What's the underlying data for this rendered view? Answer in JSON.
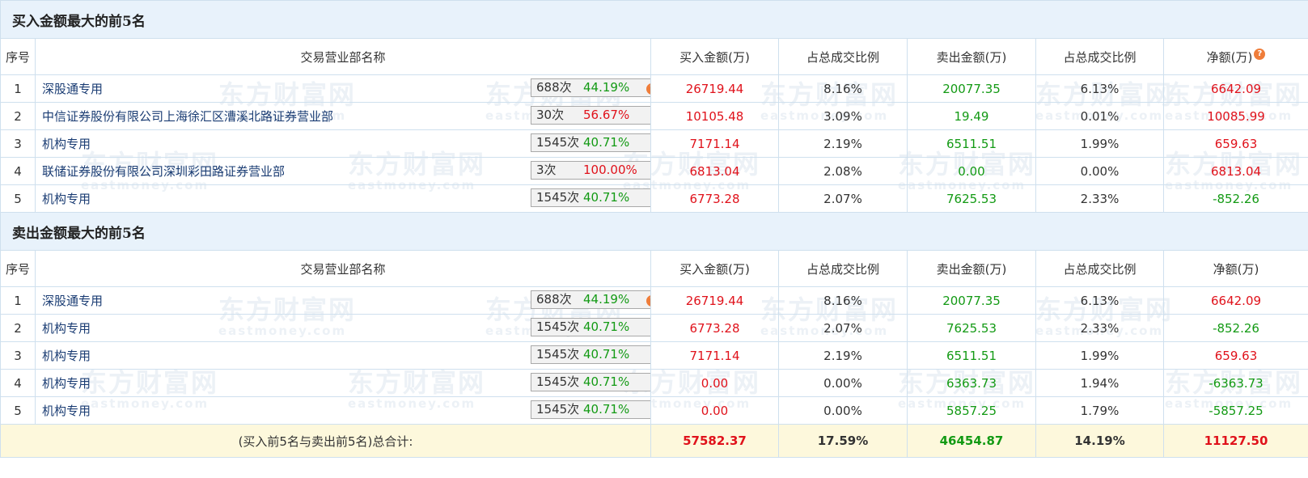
{
  "watermark": {
    "cn": "东方财富网",
    "en": "eastmoney.com"
  },
  "buy_section": {
    "title": "买入金额最大的前5名",
    "headers": [
      "序号",
      "交易营业部名称",
      "买入金额(万)",
      "占总成交比例",
      "卖出金额(万)",
      "占总成交比例",
      "净额(万)"
    ],
    "header_help_icon": "?",
    "rows": [
      {
        "idx": "1",
        "name": "深股通专用",
        "count": "688次",
        "pct": "44.19%",
        "pct_color": "green",
        "icon": "help",
        "buy": "26719.44",
        "buy_ratio": "8.16%",
        "sell": "20077.35",
        "sell_ratio": "6.13%",
        "net": "6642.09",
        "net_color": "red"
      },
      {
        "idx": "2",
        "name": "中信证券股份有限公司上海徐汇区漕溪北路证券营业部",
        "count": "30次",
        "pct": "56.67%",
        "pct_color": "red",
        "icon": "arrow",
        "buy": "10105.48",
        "buy_ratio": "3.09%",
        "sell": "19.49",
        "sell_ratio": "0.01%",
        "net": "10085.99",
        "net_color": "red"
      },
      {
        "idx": "3",
        "name": "机构专用",
        "count": "1545次",
        "pct": "40.71%",
        "pct_color": "green",
        "icon": "arrow",
        "buy": "7171.14",
        "buy_ratio": "2.19%",
        "sell": "6511.51",
        "sell_ratio": "1.99%",
        "net": "659.63",
        "net_color": "red"
      },
      {
        "idx": "4",
        "name": "联储证券股份有限公司深圳彩田路证券营业部",
        "count": "3次",
        "pct": "100.00%",
        "pct_color": "red",
        "icon": "arrow",
        "buy": "6813.04",
        "buy_ratio": "2.08%",
        "sell": "0.00",
        "sell_ratio": "0.00%",
        "net": "6813.04",
        "net_color": "red"
      },
      {
        "idx": "5",
        "name": "机构专用",
        "count": "1545次",
        "pct": "40.71%",
        "pct_color": "green",
        "icon": "arrow",
        "buy": "6773.28",
        "buy_ratio": "2.07%",
        "sell": "7625.53",
        "sell_ratio": "2.33%",
        "net": "-852.26",
        "net_color": "green"
      }
    ]
  },
  "sell_section": {
    "title": "卖出金额最大的前5名",
    "headers": [
      "序号",
      "交易营业部名称",
      "买入金额(万)",
      "占总成交比例",
      "卖出金额(万)",
      "占总成交比例",
      "净额(万)"
    ],
    "rows": [
      {
        "idx": "1",
        "name": "深股通专用",
        "count": "688次",
        "pct": "44.19%",
        "pct_color": "green",
        "icon": "help",
        "buy": "26719.44",
        "buy_ratio": "8.16%",
        "sell": "20077.35",
        "sell_ratio": "6.13%",
        "net": "6642.09",
        "net_color": "red"
      },
      {
        "idx": "2",
        "name": "机构专用",
        "count": "1545次",
        "pct": "40.71%",
        "pct_color": "green",
        "icon": "arrow",
        "buy": "6773.28",
        "buy_ratio": "2.07%",
        "sell": "7625.53",
        "sell_ratio": "2.33%",
        "net": "-852.26",
        "net_color": "green"
      },
      {
        "idx": "3",
        "name": "机构专用",
        "count": "1545次",
        "pct": "40.71%",
        "pct_color": "green",
        "icon": "arrow",
        "buy": "7171.14",
        "buy_ratio": "2.19%",
        "sell": "6511.51",
        "sell_ratio": "1.99%",
        "net": "659.63",
        "net_color": "red"
      },
      {
        "idx": "4",
        "name": "机构专用",
        "count": "1545次",
        "pct": "40.71%",
        "pct_color": "green",
        "icon": "arrow",
        "buy": "0.00",
        "buy_ratio": "0.00%",
        "sell": "6363.73",
        "sell_ratio": "1.94%",
        "net": "-6363.73",
        "net_color": "green"
      },
      {
        "idx": "5",
        "name": "机构专用",
        "count": "1545次",
        "pct": "40.71%",
        "pct_color": "green",
        "icon": "arrow",
        "buy": "0.00",
        "buy_ratio": "0.00%",
        "sell": "5857.25",
        "sell_ratio": "1.79%",
        "net": "-5857.25",
        "net_color": "green"
      }
    ]
  },
  "total": {
    "label": "(买入前5名与卖出前5名)总合计:",
    "buy": "57582.37",
    "buy_ratio": "17.59%",
    "sell": "46454.87",
    "sell_ratio": "14.19%",
    "net": "11127.50"
  },
  "colors": {
    "up": "#e0121b",
    "down": "#139a14",
    "header_bg": "#e8f2fb",
    "total_bg": "#fdf8dc",
    "link": "#1a3c73"
  }
}
